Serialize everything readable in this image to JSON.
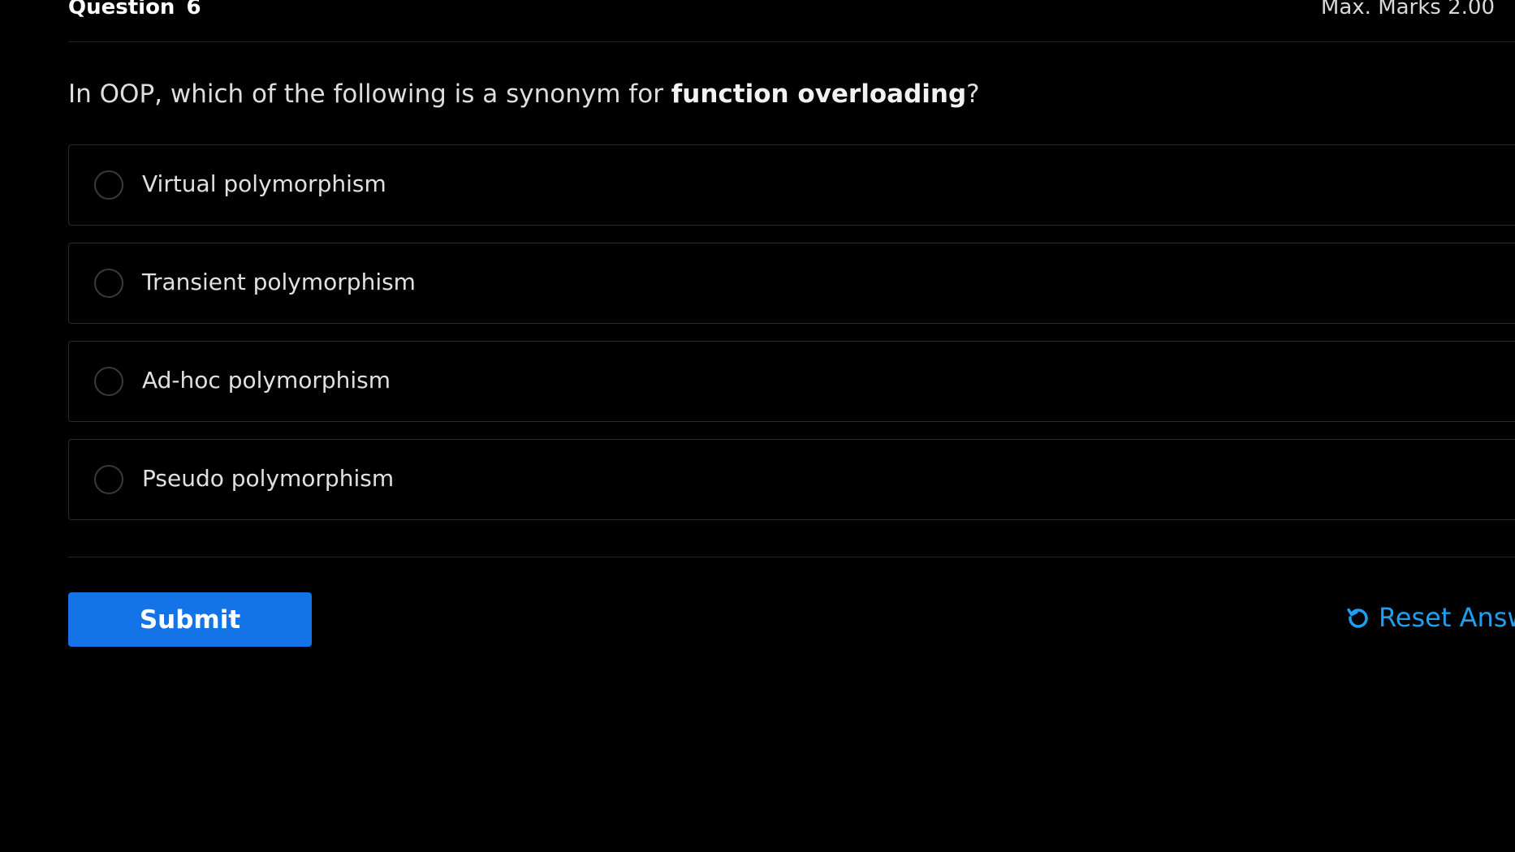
{
  "header": {
    "question_label": "Question",
    "question_number": "6",
    "max_marks": "Max. Marks 2.00"
  },
  "question": {
    "text_before": "In OOP, which of the following is a synonym for ",
    "text_bold": "function overloading",
    "text_after": "?"
  },
  "options": [
    {
      "label": "Virtual polymorphism",
      "selected": false
    },
    {
      "label": "Transient polymorphism",
      "selected": false
    },
    {
      "label": "Ad-hoc polymorphism",
      "selected": false
    },
    {
      "label": "Pseudo polymorphism",
      "selected": false
    }
  ],
  "actions": {
    "submit_label": "Submit",
    "reset_label": "Reset Answ",
    "reset_icon": "reset-icon"
  },
  "colors": {
    "background": "#000000",
    "submit_bg": "#1473e6",
    "link": "#1ea0f0"
  }
}
